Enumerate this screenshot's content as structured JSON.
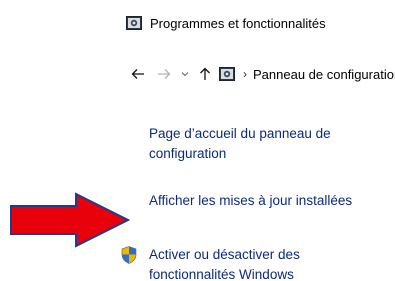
{
  "window": {
    "title": "Programmes et fonctionnalités",
    "icon": "control-panel-icon"
  },
  "navigation": {
    "back_icon": "back-arrow-icon",
    "forward_icon": "forward-arrow-icon",
    "recent_icon": "chevron-down-icon",
    "up_icon": "up-arrow-icon",
    "breadcrumb_separator": "›",
    "breadcrumb_text": "Panneau de configuration"
  },
  "sidebar": {
    "home_link": "Page d’accueil du panneau de configuration",
    "updates_link": "Afficher les mises à jour installées",
    "features_link": "Activer ou désactiver des fonctionnalités Windows",
    "features_icon": "uac-shield-icon"
  },
  "annotation": {
    "arrow_icon": "red-arrow-icon",
    "arrow_color": "#e8000b"
  }
}
